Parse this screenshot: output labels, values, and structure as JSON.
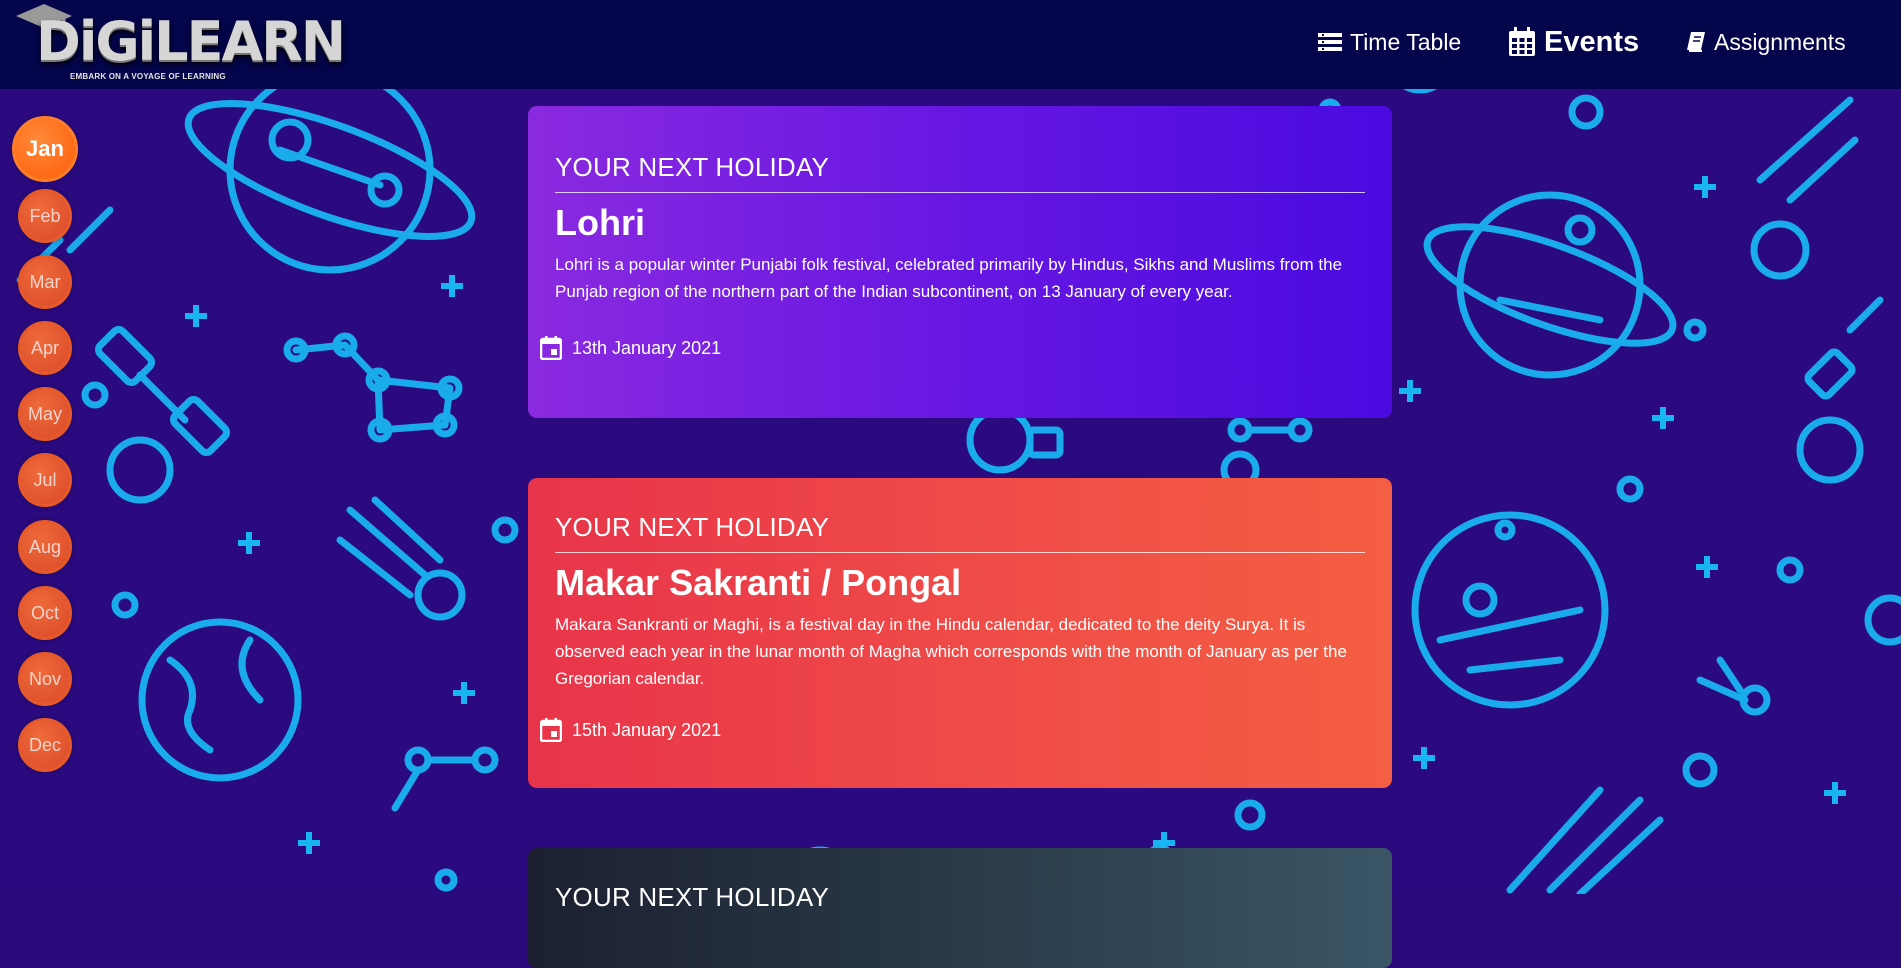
{
  "brand": {
    "name": "DiGiLEARN",
    "tagline": "EMBARK ON A VOYAGE OF LEARNING"
  },
  "nav": {
    "links": [
      {
        "label": "Time Table",
        "icon": "list-icon"
      },
      {
        "label": "Events",
        "icon": "calendar-icon",
        "active": true
      },
      {
        "label": "Assignments",
        "icon": "book-icon"
      }
    ]
  },
  "months": [
    "Jan",
    "Feb",
    "Mar",
    "Apr",
    "May",
    "Jul",
    "Aug",
    "Oct",
    "Nov",
    "Dec"
  ],
  "active_month": "Jan",
  "events": [
    {
      "kicker": "YOUR NEXT HOLIDAY",
      "title": "Lohri",
      "description": "Lohri is a popular winter Punjabi folk festival, celebrated primarily by Hindus, Sikhs and Muslims from the Punjab region of the northern part of the Indian subcontinent, on 13 January of every year.",
      "date": "13th January 2021"
    },
    {
      "kicker": "YOUR NEXT HOLIDAY",
      "title": "Makar Sakranti / Pongal",
      "description": "Makara Sankranti or Maghi, is a festival day in the Hindu calendar, dedicated to the deity Surya. It is observed each year in the lunar month of Magha which corresponds with the month of January as per the Gregorian calendar.",
      "date": "15th January 2021"
    },
    {
      "kicker": "YOUR NEXT HOLIDAY"
    }
  ],
  "colors": {
    "navbar": "#04054a",
    "background": "#2b0a80",
    "pattern": "#1fb3f0",
    "month_active": "#ff6a16",
    "month": "#e0532e"
  }
}
